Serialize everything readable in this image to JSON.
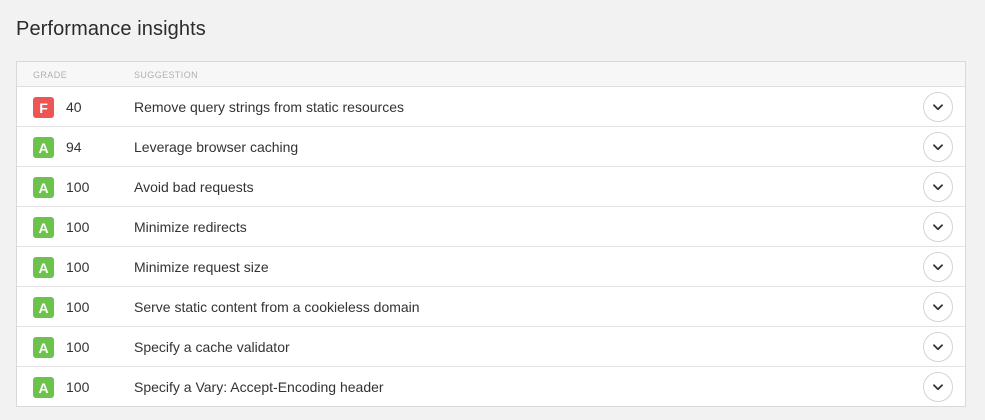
{
  "title": "Performance insights",
  "table": {
    "header_grade": "GRADE",
    "header_suggestion": "SUGGESTION"
  },
  "colors": {
    "grade_F": "#f05555",
    "grade_A": "#6cc24a"
  },
  "rows": [
    {
      "grade": "F",
      "score": "40",
      "suggestion": "Remove query strings from static resources",
      "expand_icon": "chevron-down-icon"
    },
    {
      "grade": "A",
      "score": "94",
      "suggestion": "Leverage browser caching",
      "expand_icon": "chevron-down-icon"
    },
    {
      "grade": "A",
      "score": "100",
      "suggestion": "Avoid bad requests",
      "expand_icon": "chevron-down-icon"
    },
    {
      "grade": "A",
      "score": "100",
      "suggestion": "Minimize redirects",
      "expand_icon": "chevron-down-icon"
    },
    {
      "grade": "A",
      "score": "100",
      "suggestion": "Minimize request size",
      "expand_icon": "chevron-down-icon"
    },
    {
      "grade": "A",
      "score": "100",
      "suggestion": "Serve static content from a cookieless domain",
      "expand_icon": "chevron-down-icon"
    },
    {
      "grade": "A",
      "score": "100",
      "suggestion": "Specify a cache validator",
      "expand_icon": "chevron-down-icon"
    },
    {
      "grade": "A",
      "score": "100",
      "suggestion": "Specify a Vary: Accept-Encoding header",
      "expand_icon": "chevron-down-icon"
    }
  ]
}
